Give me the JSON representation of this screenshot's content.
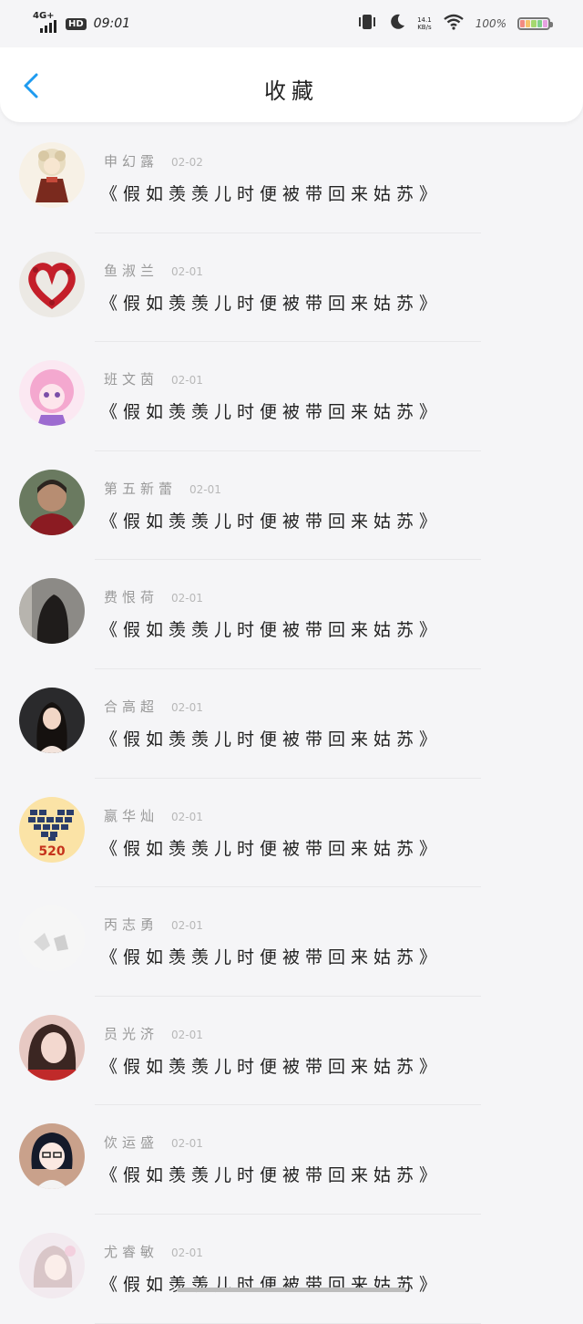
{
  "status": {
    "network": "4G+",
    "hd": "HD",
    "time": "09:01",
    "speed_value": "14.1",
    "speed_unit": "KB/s",
    "battery": "100%"
  },
  "header": {
    "title": "收藏"
  },
  "items": [
    {
      "name": "申幻露",
      "date": "02-02",
      "text": "《假如羡羡儿时便被带回来姑苏》"
    },
    {
      "name": "鱼淑兰",
      "date": "02-01",
      "text": "《假如羡羡儿时便被带回来姑苏》"
    },
    {
      "name": "班文茵",
      "date": "02-01",
      "text": "《假如羡羡儿时便被带回来姑苏》"
    },
    {
      "name": "第五新蕾",
      "date": "02-01",
      "text": "《假如羡羡儿时便被带回来姑苏》"
    },
    {
      "name": "费恨荷",
      "date": "02-01",
      "text": "《假如羡羡儿时便被带回来姑苏》"
    },
    {
      "name": "合高超",
      "date": "02-01",
      "text": "《假如羡羡儿时便被带回来姑苏》"
    },
    {
      "name": "嬴华灿",
      "date": "02-01",
      "text": "《假如羡羡儿时便被带回来姑苏》",
      "avatar_text": "520"
    },
    {
      "name": "丙志勇",
      "date": "02-01",
      "text": "《假如羡羡儿时便被带回来姑苏》"
    },
    {
      "name": "员光济",
      "date": "02-01",
      "text": "《假如羡羡儿时便被带回来姑苏》"
    },
    {
      "name": "佽运盛",
      "date": "02-01",
      "text": "《假如羡羡儿时便被带回来姑苏》"
    },
    {
      "name": "尤睿敏",
      "date": "02-01",
      "text": "《假如羡羡儿时便被带回来姑苏》"
    }
  ],
  "colors": {
    "accent": "#1e9bf0",
    "name": "#999999",
    "date": "#b8b8b8",
    "text": "#222222"
  }
}
